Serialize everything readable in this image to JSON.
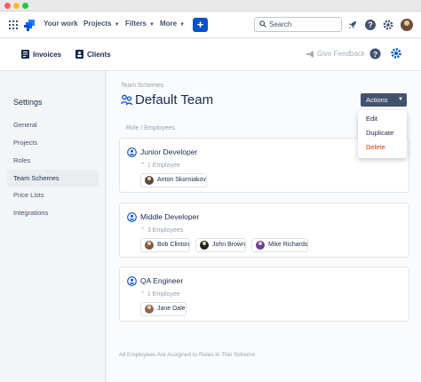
{
  "topnav": {
    "items": [
      {
        "label": "Your work"
      },
      {
        "label": "Projects"
      },
      {
        "label": "Filters"
      },
      {
        "label": "More"
      }
    ],
    "create_label": "+",
    "search_placeholder": "Search",
    "icons": [
      "apps-grid-icon",
      "jira-logo-icon",
      "rocket-icon",
      "help-icon",
      "gear-icon",
      "avatar"
    ]
  },
  "subnav": {
    "invoices_label": "Invoices",
    "clients_label": "Clients",
    "feedback_label": "Give Feedback"
  },
  "sidebar": {
    "title": "Settings",
    "items": [
      {
        "label": "General",
        "active": false
      },
      {
        "label": "Projects",
        "active": false
      },
      {
        "label": "Roles",
        "active": false
      },
      {
        "label": "Team Schemes",
        "active": true
      },
      {
        "label": "Price Lists",
        "active": false
      },
      {
        "label": "Integrations",
        "active": false
      }
    ]
  },
  "main": {
    "breadcrumb": "Team Schemes",
    "title": "Default Team",
    "column_header": "Role / Employees",
    "actions_label": "Actions",
    "dropdown": [
      {
        "label": "Edit"
      },
      {
        "label": "Duplicate"
      },
      {
        "label": "Delete"
      }
    ],
    "roles": [
      {
        "name": "Junior Developer",
        "count": "1 Employee",
        "employees": [
          "Anton Skorniakov"
        ]
      },
      {
        "name": "Middle Developer",
        "count": "3 Employees",
        "employees": [
          "Bob Clinton",
          "John Brown",
          "Mike Richards"
        ]
      },
      {
        "name": "QA Engineer",
        "count": "1 Employee",
        "employees": [
          "Jane Dale"
        ]
      }
    ],
    "footer_note": "All Employees Are Assigned to Roles in This Scheme"
  },
  "colors": {
    "primary": "#0052cc",
    "actions_bg": "#42526e",
    "danger": "#de350b",
    "muted": "#97a0af"
  }
}
